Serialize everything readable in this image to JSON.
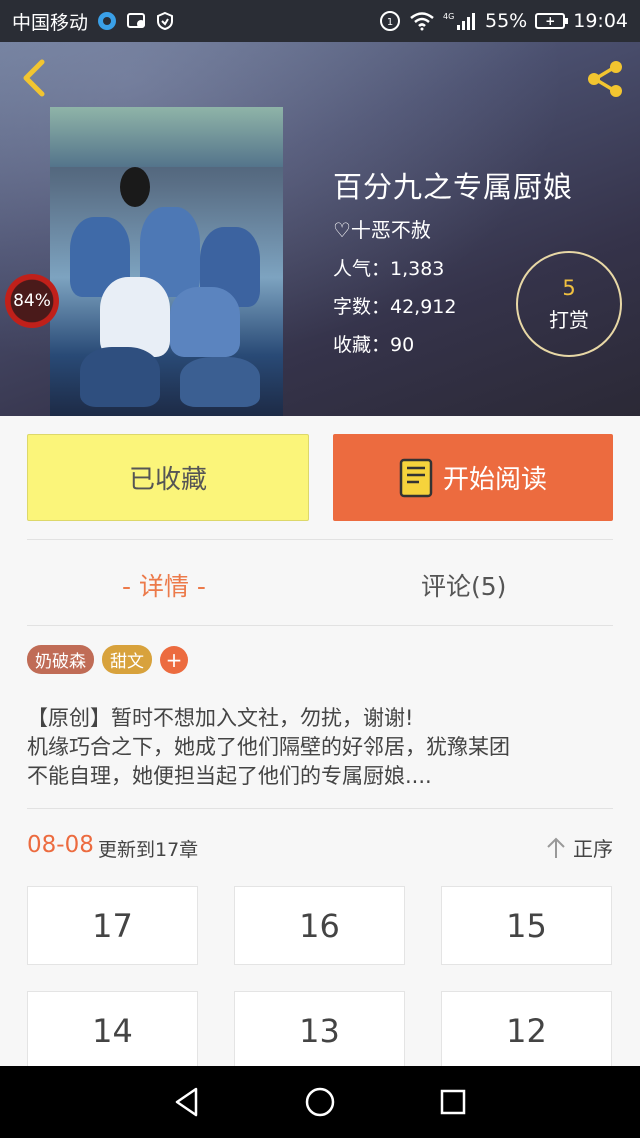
{
  "status_bar": {
    "carrier": "中国移动",
    "battery": "55%",
    "time": "19:04",
    "network": "4G"
  },
  "book": {
    "title": "百分九之专属厨娘",
    "author": "♡十恶不赦",
    "popularity": "人气：1,383",
    "words": "字数：42,912",
    "favorites": "收藏：90",
    "read_progress": "84%",
    "reward_count": "5",
    "reward_label": "打赏"
  },
  "actions": {
    "collected_label": "已收藏",
    "read_label": "开始阅读"
  },
  "tabs": {
    "detail": "- 详情 -",
    "comments": "评论(5)"
  },
  "tags": [
    "奶破森",
    "甜文"
  ],
  "tag_add": "+",
  "description": [
    "【原创】暂时不想加入文社，勿扰，谢谢!",
    "机缘巧合之下，她成了他们隔壁的好邻居，犹豫某团",
    "不能自理，她便担当起了他们的专属厨娘...."
  ],
  "chapters_header": {
    "date": "08-08",
    "update_text": "更新到17章",
    "sort_label": "正序"
  },
  "chapters": [
    "17",
    "16",
    "15",
    "14",
    "13",
    "12"
  ],
  "colors": {
    "accent": "#ec6b3f",
    "collected_bg": "#fbf57a",
    "reward_gold": "#f0c040"
  }
}
